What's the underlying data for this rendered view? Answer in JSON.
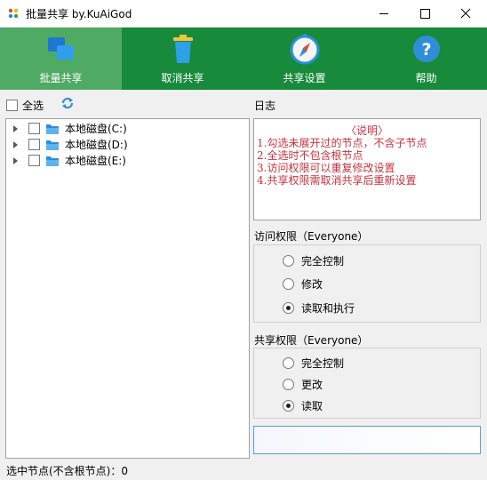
{
  "window": {
    "title": "批量共享 by.KuAiGod"
  },
  "toolbar": {
    "items": [
      {
        "label": "批量共享",
        "icon": "windows-share-icon",
        "active": true
      },
      {
        "label": "取消共享",
        "icon": "trash-icon",
        "active": false
      },
      {
        "label": "共享设置",
        "icon": "compass-icon",
        "active": false
      },
      {
        "label": "帮助",
        "icon": "help-icon",
        "active": false
      }
    ]
  },
  "left": {
    "select_all_label": "全选",
    "tree": [
      {
        "label": "本地磁盘(C:)",
        "checked": false
      },
      {
        "label": "本地磁盘(D:)",
        "checked": false
      },
      {
        "label": "本地磁盘(E:)",
        "checked": false
      }
    ],
    "status": "选中节点(不含根节点)：0"
  },
  "log": {
    "title": "日志",
    "heading": "说明",
    "lines": [
      "1.勾选未展开过的节点，不含子节点",
      "2.全选时不包含根节点",
      "3.访问权限可以重复修改设置",
      "4.共享权限需取消共享后重新设置"
    ]
  },
  "access": {
    "title": "访问权限（Everyone）",
    "options": [
      "完全控制",
      "修改",
      "读取和执行"
    ],
    "selected": "读取和执行"
  },
  "share": {
    "title": "共享权限（Everyone）",
    "options": [
      "完全控制",
      "更改",
      "读取"
    ],
    "selected": "读取"
  },
  "colors": {
    "toolbar_bg": "#178a3b",
    "toolbar_active": "#4faa63",
    "log_text": "#c8323c"
  }
}
